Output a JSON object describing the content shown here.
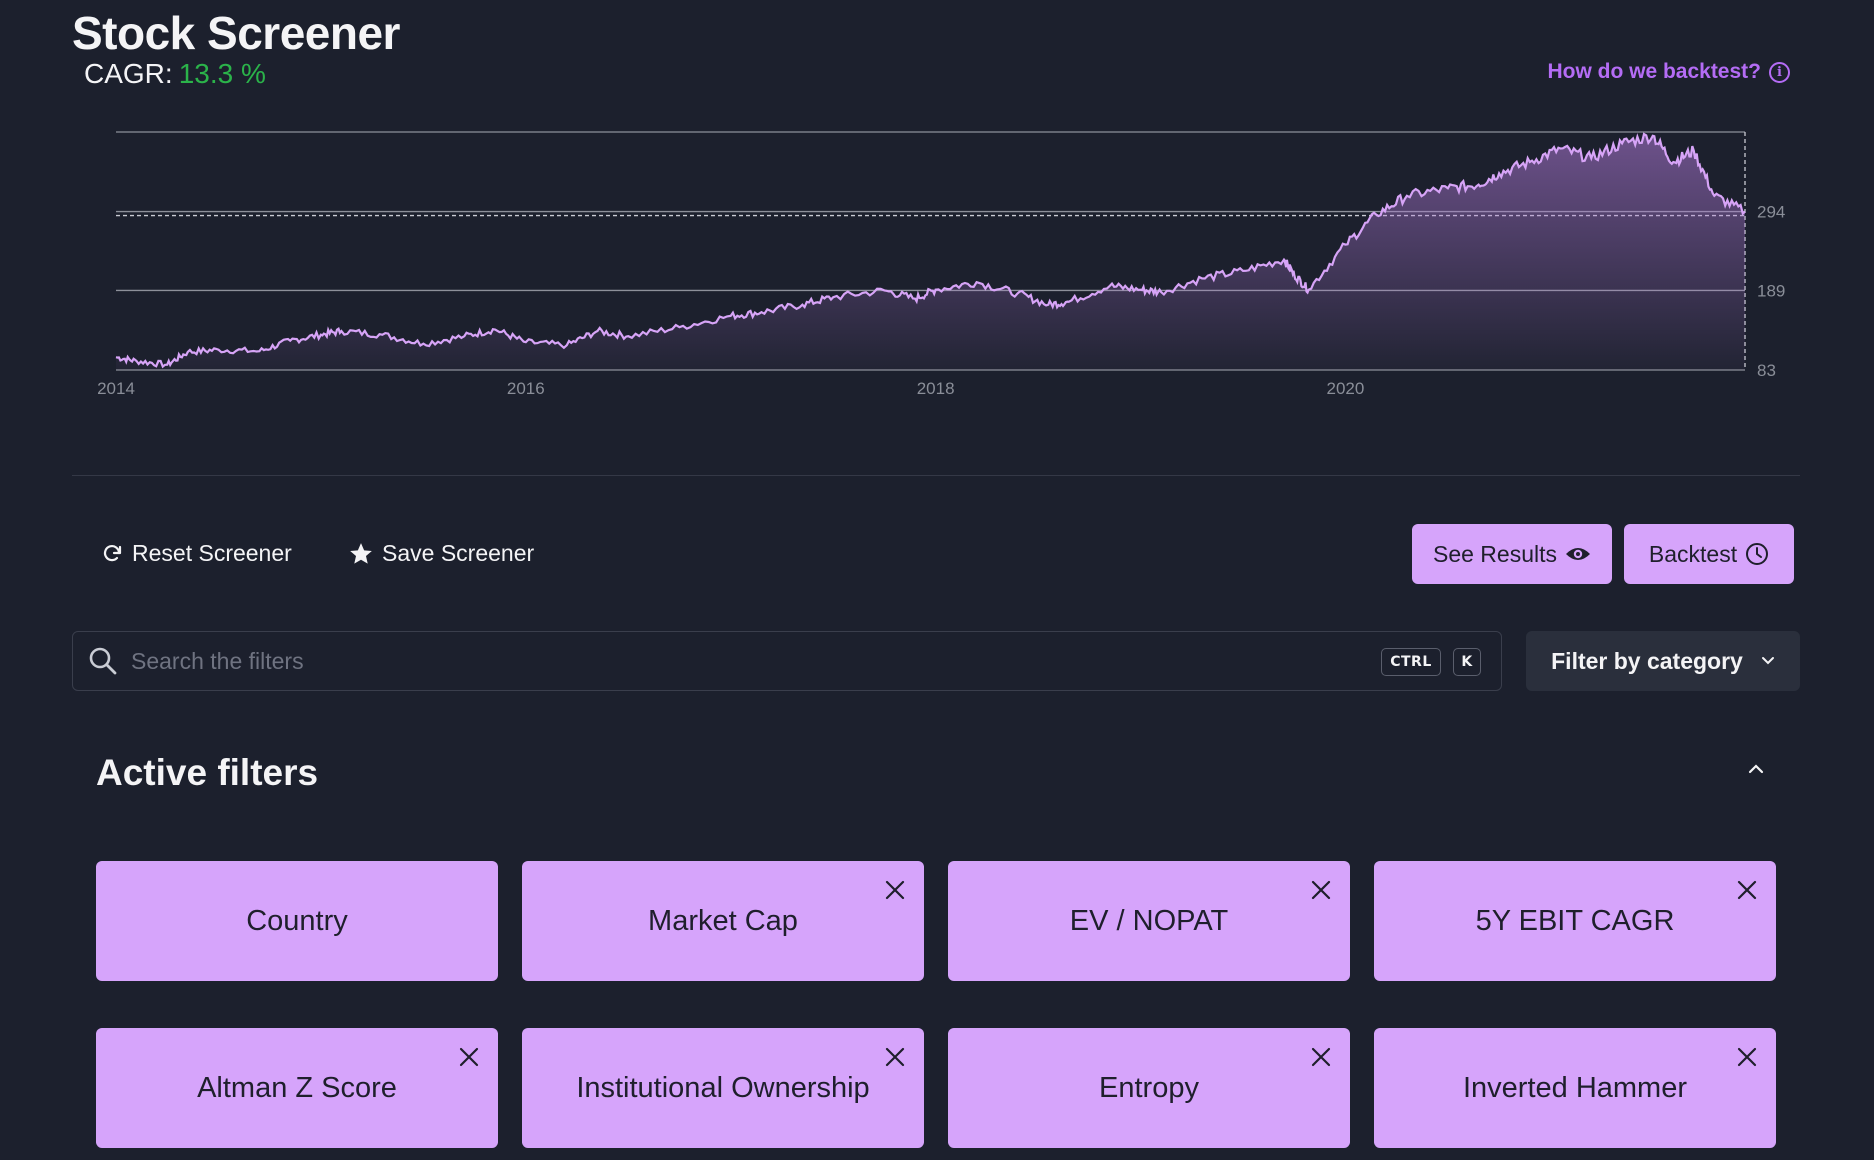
{
  "header": {
    "title": "Stock Screener",
    "cagr_label": "CAGR:",
    "cagr_value": "13.3 %",
    "backtest_help_link": "How do we backtest?"
  },
  "colors": {
    "accent": "#d6a4fb",
    "link": "#b46cf5",
    "positive": "#2bb34a",
    "background": "#1c202d"
  },
  "chart_data": {
    "type": "area",
    "x_ticks": [
      "2014",
      "2016",
      "2018",
      "2020"
    ],
    "y_ticks": [
      "83",
      "189",
      "294"
    ],
    "ylim": [
      83,
      400
    ],
    "xlim": [
      2014.0,
      2021.95
    ],
    "reference_line": 294,
    "grid": true,
    "series": [
      {
        "x": [
          2014.0,
          2014.1,
          2014.25,
          2014.35,
          2014.5,
          2014.7,
          2014.85,
          2015.0,
          2015.1,
          2015.3,
          2015.5,
          2015.7,
          2015.85,
          2016.0,
          2016.2,
          2016.35,
          2016.5,
          2016.75,
          2017.0,
          2017.15,
          2017.35,
          2017.5,
          2017.75,
          2017.9,
          2018.0,
          2018.2,
          2018.4,
          2018.55,
          2018.65,
          2018.85,
          2019.0,
          2019.1,
          2019.3,
          2019.5,
          2019.7,
          2019.75,
          2019.82,
          2020.0,
          2020.15,
          2020.3,
          2020.5,
          2020.65,
          2020.75,
          2020.9,
          2021.05,
          2021.2,
          2021.35,
          2021.5,
          2021.6,
          2021.7,
          2021.8,
          2021.95
        ],
        "y": [
          100,
          95,
          90,
          107,
          110,
          108,
          122,
          130,
          135,
          130,
          118,
          128,
          137,
          120,
          116,
          135,
          128,
          140,
          155,
          160,
          170,
          180,
          189,
          178,
          190,
          200,
          185,
          170,
          174,
          195,
          190,
          187,
          205,
          215,
          230,
          210,
          190,
          250,
          290,
          315,
          325,
          330,
          345,
          360,
          378,
          365,
          385,
          395,
          360,
          375,
          315,
          294
        ]
      }
    ]
  },
  "actions": {
    "reset": "Reset Screener",
    "save": "Save Screener",
    "see_results": "See Results",
    "backtest": "Backtest"
  },
  "search": {
    "placeholder": "Search the filters",
    "value": "",
    "shortcut_ctrl": "CTRL",
    "shortcut_key": "K"
  },
  "filter_by_category": "Filter by category",
  "active_filters": {
    "title": "Active filters",
    "items": [
      {
        "label": "Country"
      },
      {
        "label": "Market Cap"
      },
      {
        "label": "EV / NOPAT"
      },
      {
        "label": "5Y EBIT CAGR"
      },
      {
        "label": "Altman Z Score"
      },
      {
        "label": "Institutional Ownership"
      },
      {
        "label": "Entropy"
      },
      {
        "label": "Inverted Hammer"
      }
    ]
  }
}
